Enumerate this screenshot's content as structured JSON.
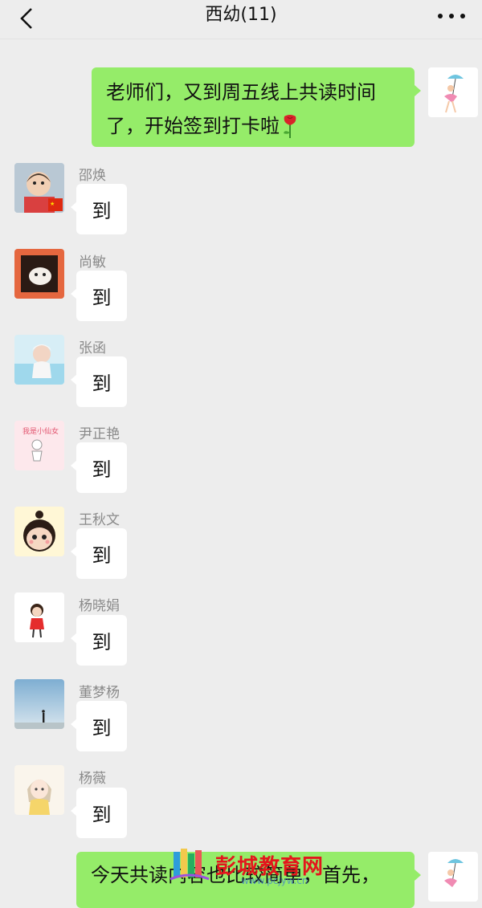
{
  "header": {
    "title": "西幼(11)",
    "back_icon": "chevron-left-icon",
    "more_icon": "more-dots-icon"
  },
  "messages": [
    {
      "sender": "self",
      "text_line1": "老师们，又到周五线上共读时间",
      "text_line2": "了，开始签到打卡啦",
      "emoji": "rose-emoji"
    },
    {
      "sender": "邵焕",
      "text": "到"
    },
    {
      "sender": "尚敏",
      "text": "到"
    },
    {
      "sender": "张函",
      "text": "到"
    },
    {
      "sender": "尹正艳",
      "text": "到"
    },
    {
      "sender": "王秋文",
      "text": "到"
    },
    {
      "sender": "杨晓娟",
      "text": "到"
    },
    {
      "sender": "董梦杨",
      "text": "到"
    },
    {
      "sender": "杨薇",
      "text": "到"
    },
    {
      "sender": "self",
      "text": "今天共读内容也比较简单，首先，"
    }
  ],
  "watermark": {
    "text": "彭城教育网",
    "url": "www.pcjyw.cn"
  },
  "colors": {
    "background": "#ededed",
    "outgoing_bubble": "#95ec69",
    "incoming_bubble": "#ffffff"
  }
}
